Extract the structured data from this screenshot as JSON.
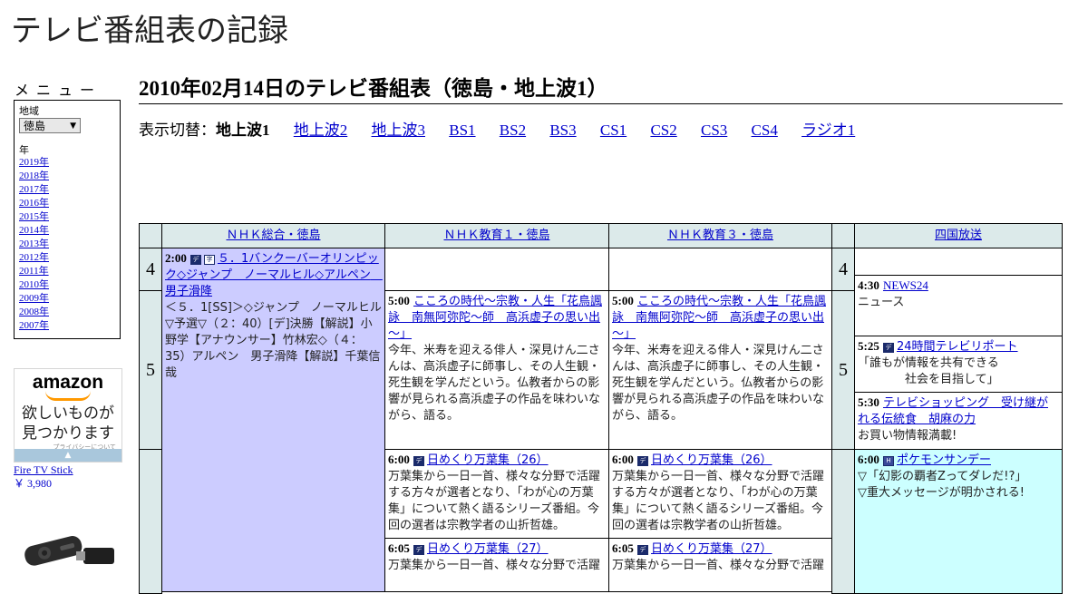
{
  "site": {
    "title": "テレビ番組表の記録"
  },
  "menu": {
    "heading": "メニュー",
    "region_label": "地域",
    "region_value": "徳島",
    "year_label": "年",
    "years": [
      "2019年",
      "2018年",
      "2017年",
      "2016年",
      "2015年",
      "2014年",
      "2013年",
      "2012年",
      "2011年",
      "2010年",
      "2009年",
      "2008年",
      "2007年"
    ]
  },
  "ad": {
    "logo": "amazon",
    "text_line1": "欲しいものが",
    "text_line2": "見つかります",
    "privacy": "プライバシーについて",
    "product": "Fire TV Stick",
    "price": "￥ 3,980"
  },
  "page": {
    "heading": "2010年02月14日のテレビ番組表（徳島・地上波1）",
    "switch_label": "表示切替：",
    "current": "地上波1",
    "links": [
      "地上波2",
      "地上波3",
      "BS1",
      "BS2",
      "BS3",
      "CS1",
      "CS2",
      "CS3",
      "CS4",
      "ラジオ1"
    ]
  },
  "channels": [
    "ＮＨＫ総合・徳島",
    "ＮＨＫ教育１・徳島",
    "ＮＨＫ教育３・徳島",
    "四国放送"
  ],
  "hours": [
    "4",
    "5"
  ],
  "programs": {
    "nhk_sogo_200": {
      "time": "2:00",
      "title": "５．1バンクーバーオリンピック◇ジャンプ　ノーマルヒル◇アルペン　男子滑降",
      "desc": "＜５．1[SS]＞◇ジャンプ　ノーマルヒル▽予選▽（２：40）[デ]決勝【解説】小野学【アナウンサー】竹林宏◇（４：35）アルペン　男子滑降【解説】千葉信哉"
    },
    "edu1_500": {
      "time": "5:00",
      "title": "こころの時代～宗教・人生「花鳥諷詠　南無阿弥陀～師　高浜虚子の思い出～」",
      "desc": "今年、米寿を迎える俳人・深見けん二さんは、高浜虚子に師事し、その人生観・死生観を学んだという。仏教者からの影響が見られる高浜虚子の作品を味わいながら、語る。"
    },
    "edu3_500": {
      "time": "5:00",
      "title": "こころの時代～宗教・人生「花鳥諷詠　南無阿弥陀～師　高浜虚子の思い出～」",
      "desc": "今年、米寿を迎える俳人・深見けん二さんは、高浜虚子に師事し、その人生観・死生観を学んだという。仏教者からの影響が見られる高浜虚子の作品を味わいながら、語る。"
    },
    "edu1_600": {
      "time": "6:00",
      "title": "日めくり万葉集（26）",
      "desc": "万葉集から一日一首、様々な分野で活躍する方々が選者となり、「わが心の万葉集」について熱く語るシリーズ番組。今回の選者は宗教学者の山折哲雄。"
    },
    "edu3_600": {
      "time": "6:00",
      "title": "日めくり万葉集（26）",
      "desc": "万葉集から一日一首、様々な分野で活躍する方々が選者となり、「わが心の万葉集」について熱く語るシリーズ番組。今回の選者は宗教学者の山折哲雄。"
    },
    "edu1_605": {
      "time": "6:05",
      "title": "日めくり万葉集（27）",
      "desc": "万葉集から一日一首、様々な分野で活躍"
    },
    "edu3_605": {
      "time": "6:05",
      "title": "日めくり万葉集（27）",
      "desc": "万葉集から一日一首、様々な分野で活躍"
    },
    "shikoku_430": {
      "time": "4:30",
      "title": "NEWS24",
      "desc": "ニュース"
    },
    "shikoku_525": {
      "time": "5:25",
      "title": "24時間テレビリポート",
      "desc1": "「誰もが情報を共有できる",
      "desc2": "社会を目指して」"
    },
    "shikoku_530": {
      "time": "5:30",
      "title": "テレビショッピング　受け継がれる伝統食　胡麻の力",
      "desc": "お買い物情報満載!"
    },
    "shikoku_600": {
      "time": "6:00",
      "title": "ポケモンサンデー",
      "desc1": "▽「幻影の覇者Zってダレだ!?」",
      "desc2": "▽重大メッセージが明かされる!"
    }
  },
  "icons": {
    "data": "データ放送",
    "subtitle": "字幕",
    "hd": "ハイビジョン"
  }
}
